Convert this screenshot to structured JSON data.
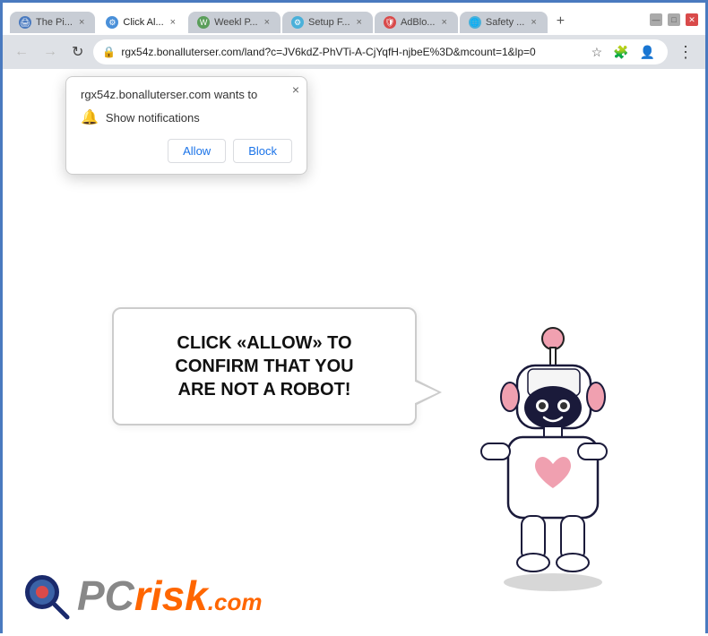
{
  "browser": {
    "title": "Browser",
    "tabs": [
      {
        "id": "tab1",
        "label": "The Pi...",
        "favicon_color": "#4a7abf",
        "active": false,
        "favicon_char": "🖨"
      },
      {
        "id": "tab2",
        "label": "Click Al...",
        "favicon_color": "#4a90d9",
        "active": true,
        "favicon_char": "⚙"
      },
      {
        "id": "tab3",
        "label": "Weekl P...",
        "favicon_color": "#5a9e5a",
        "active": false,
        "favicon_char": "W"
      },
      {
        "id": "tab4",
        "label": "Setup F...",
        "favicon_color": "#4ab0d9",
        "active": false,
        "favicon_char": "⚙"
      },
      {
        "id": "tab5",
        "label": "AdBlo...",
        "favicon_color": "#d94a4a",
        "active": false,
        "favicon_char": "🛡"
      },
      {
        "id": "tab6",
        "label": "Safety ...",
        "favicon_color": "#4ab0d9",
        "active": false,
        "favicon_char": "🌐"
      }
    ],
    "address": "rgx54z.bonalluterser.com/land?c=JV6kdZ-PhVTi-A-CjYqfH-njbeE%3D&mcount=1&lp=0",
    "window_controls": {
      "minimize": "—",
      "maximize": "□",
      "close": "✕"
    }
  },
  "popup": {
    "title": "rgx54z.bonalluterser.com wants to",
    "notification_text": "Show notifications",
    "allow_label": "Allow",
    "block_label": "Block"
  },
  "main": {
    "bubble_text_line1": "CLICK «ALLOW» TO CONFIRM THAT YOU",
    "bubble_text_line2": "ARE NOT A ROBOT!"
  },
  "logo": {
    "pc_text": "PC",
    "risk_text": "risk",
    "dotcom_text": ".com"
  },
  "icons": {
    "lock": "🔒",
    "bell": "🔔",
    "back": "←",
    "forward": "→",
    "reload": "↻",
    "star": "☆",
    "menu": "⋮",
    "extensions": "🧩",
    "profile": "👤",
    "close": "×"
  }
}
